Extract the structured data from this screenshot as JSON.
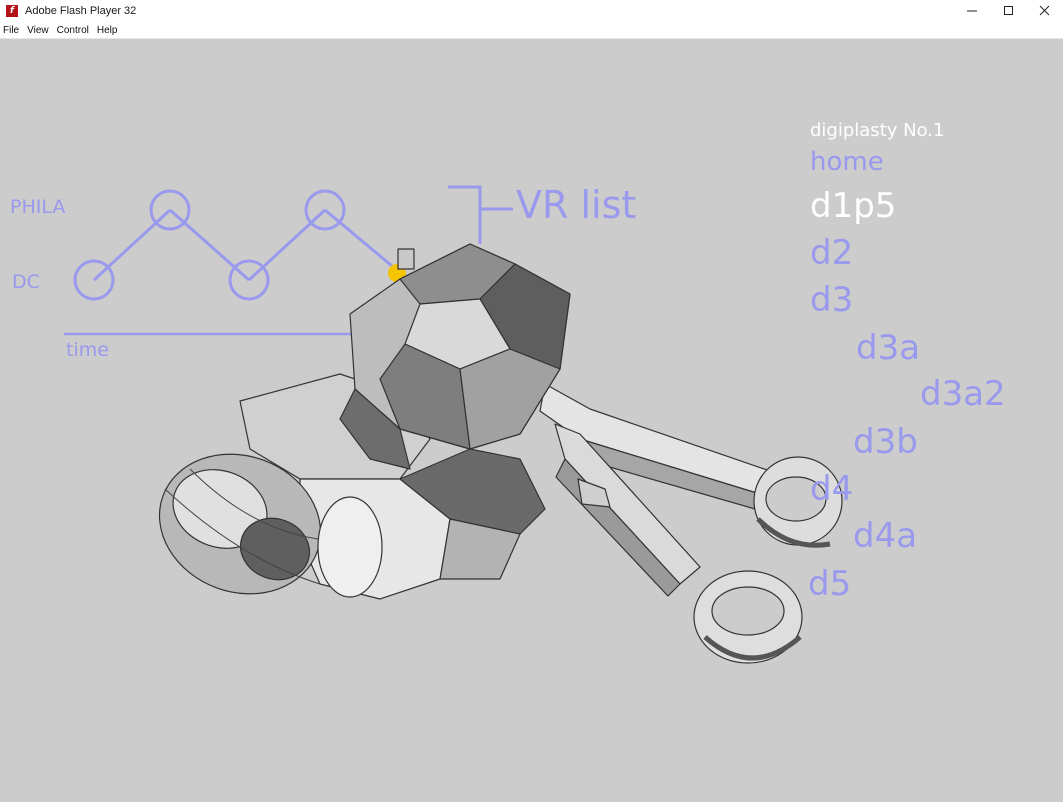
{
  "window": {
    "title": "Adobe Flash Player 32",
    "app_icon_glyph": "f"
  },
  "menu": [
    "File",
    "View",
    "Control",
    "Help"
  ],
  "timeline": {
    "labels": {
      "phila": "PHILA",
      "dc": "DC",
      "time": "time"
    },
    "vr_list": "VR list"
  },
  "nav": {
    "site_title": "digiplasty No.1",
    "items": [
      "home",
      "d1p5",
      "d2",
      "d3",
      "d3a",
      "d3a2",
      "d3b",
      "d4",
      "d4a",
      "d5"
    ],
    "current": "d1p5"
  },
  "colors": {
    "background": "#cccccc",
    "accent": "#9999ee",
    "current": "#ffffff",
    "marker": "#f5c400"
  }
}
